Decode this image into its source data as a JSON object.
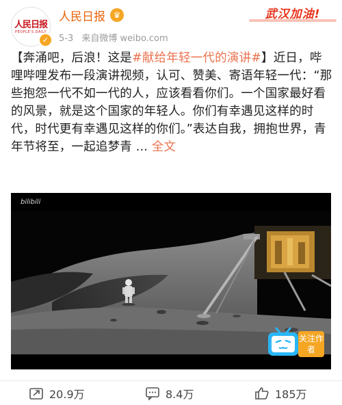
{
  "header": {
    "avatar_logo": "人民日报",
    "avatar_sub": "PEOPLE'S DAILY",
    "username": "人民日报",
    "date": "5-3",
    "source": "来自微博 weibo.com",
    "badge": "武汉加油!"
  },
  "post": {
    "p1": "【奔涌吧，后浪！这是",
    "hashtag": "#献给年轻一代的演讲#",
    "p2": "】近日，哔哩哔哩发布一段演讲视频，认可、赞美、寄语年轻一代：“那些抱怨一代不如一代的人，应该看看你们。一个国家最好看的风景，就是这个国家的年轻人。你们有幸遇见这样的时代，时代更有幸遇见这样的你们。”表达自我，拥抱世界，青年节将至，一起追梦青 ... ",
    "fulltext": "全文"
  },
  "video": {
    "watermark": "bilibili",
    "follow_label": "关注作者"
  },
  "actions": {
    "repost": "20.9万",
    "comment": "8.4万",
    "like": "185万"
  },
  "colors": {
    "accent": "#eb7350",
    "username": "#e8630a",
    "wuhan_red": "#e8341c"
  }
}
